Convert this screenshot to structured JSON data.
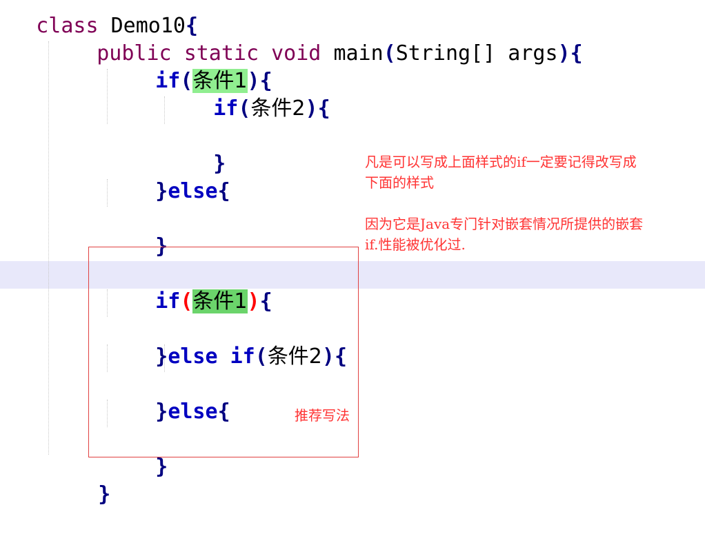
{
  "code": {
    "class_line": {
      "kw": "class",
      "name": " Demo10",
      "brace": "{"
    },
    "main_sig": {
      "kw_public": "public",
      "kw_static": "static",
      "kw_void": "void",
      "name": "main",
      "open": "(",
      "type": "String[]",
      "arg": " args",
      "close": ")",
      "brace": "{"
    },
    "top": {
      "if1_kw": "if",
      "if1_open": "(",
      "if1_cond": "条件1",
      "if1_close": ")",
      "if1_brace": "{",
      "if2_kw": "if",
      "if2_open": "(",
      "if2_cond": "条件2",
      "if2_close": ")",
      "if2_brace": "{",
      "if2_end": "}",
      "else_open": "}",
      "else_kw": "else",
      "else_brace": "{",
      "else_end": "}"
    },
    "bottom": {
      "if_kw": "if",
      "if_open": "(",
      "if_cond": "条件1",
      "if_close": ")",
      "if_brace": "{",
      "elseif_open": "}",
      "elseif_else": "else",
      "elseif_if": "if",
      "elseif_paren_open": "(",
      "elseif_cond": "条件2",
      "elseif_paren_close": ")",
      "elseif_brace": "{",
      "else_open": "}",
      "else_kw": "else",
      "else_brace": "{",
      "else_end": "}"
    },
    "main_end": "}"
  },
  "notes": {
    "note1_line1": "凡是可以写成上面样式的if一定要记得改写成",
    "note1_line2": "下面的样式",
    "note2_line1": "因为它是Java专门针对嵌套情况所提供的嵌套",
    "note2_line2": "if.性能被优化过.",
    "recommend": "推荐写法"
  },
  "colors": {
    "keyword": "#7f0055",
    "control_keyword": "#0000c0",
    "highlight": "#90ee90",
    "annotation": "#ff3333",
    "current_line": "#e8e8fa"
  }
}
